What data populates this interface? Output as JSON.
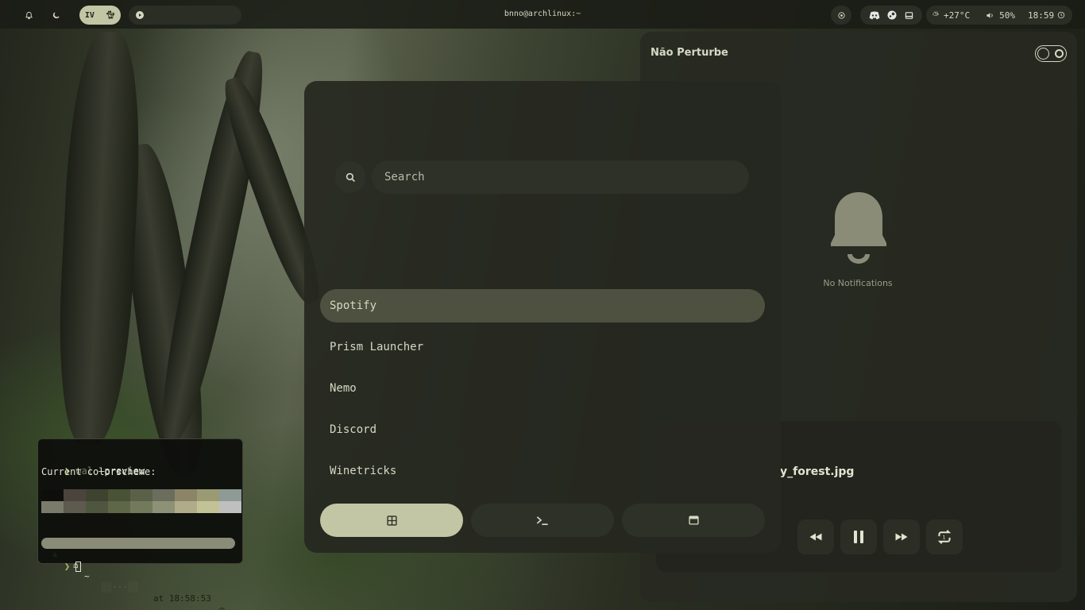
{
  "topbar": {
    "workspace_label": "IV",
    "window_title": "bnno@archlinux:~",
    "weather": "+27°C",
    "volume": "50%",
    "time": "18:59",
    "icons": [
      "bell-icon",
      "moon-icon",
      "cat-icon",
      "play-icon",
      "record-icon",
      "discord-icon",
      "steam-icon",
      "tray-icon",
      "weather-icon",
      "volume-icon",
      "clock-icon"
    ]
  },
  "launcher": {
    "search_placeholder": "Search",
    "apps": [
      {
        "label": "Spotify",
        "selected": true
      },
      {
        "label": "Prism Launcher"
      },
      {
        "label": "Nemo"
      },
      {
        "label": "Discord"
      },
      {
        "label": "Winetricks"
      }
    ],
    "tabs": [
      {
        "icon": "apps-grid-icon",
        "active": true
      },
      {
        "icon": "terminal-icon"
      },
      {
        "icon": "window-icon"
      }
    ]
  },
  "notifications": {
    "dnd_label": "Não Perturbe",
    "empty_label": "No Notifications"
  },
  "media": {
    "title": "y_forest.jpg",
    "controls": [
      "rewind-icon",
      "pause-icon",
      "fast-forward-icon",
      "repeat-icon"
    ]
  },
  "terminal": {
    "command": "wal",
    "command_args": " —preview",
    "output": "Current colorscheme:",
    "prompt_time": "at 18:58:53",
    "prompt_dir": "~",
    "palette_row1": [
      "#0e0f0c",
      "#4a443c",
      "#3e4330",
      "#4a5236",
      "#5b6149",
      "#6b6e5c",
      "#8b8466",
      "#9a9a74",
      "#8d9a96"
    ],
    "palette_row2": [
      "#7a7b6a",
      "#5f5a50",
      "#4e5640",
      "#5e6748",
      "#737a5c",
      "#8d9176",
      "#b0ab88",
      "#c2c296",
      "#bfbfc0"
    ]
  }
}
